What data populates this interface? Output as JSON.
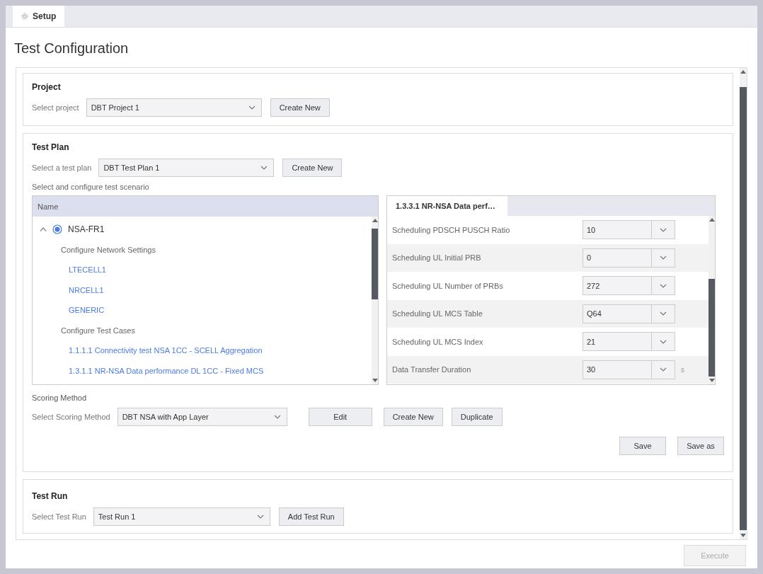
{
  "tab": {
    "label": "Setup",
    "selected": true
  },
  "title": "Test Configuration",
  "project": {
    "heading": "Project",
    "label": "Select project",
    "value": "DBT Project 1",
    "button": "Create New"
  },
  "test_plan": {
    "heading": "Test Plan",
    "label": "Select a test plan",
    "value": "DBT Test Plan 1",
    "button": "Create New",
    "scenario_label": "Select and configure test scenario",
    "tree": {
      "column": "Name",
      "items": [
        {
          "label": "NSA-FR1",
          "kind": "radio",
          "selected": true,
          "expanded": true,
          "children": [
            {
              "label": "Configure Network Settings",
              "kind": "group",
              "children": [
                {
                  "label": "LTECELL1",
                  "kind": "link"
                },
                {
                  "label": "NRCELL1",
                  "kind": "link"
                },
                {
                  "label": "GENERIC",
                  "kind": "link"
                }
              ]
            },
            {
              "label": "Configure Test Cases",
              "kind": "group",
              "children": [
                {
                  "label": "1.1.1.1 Connectivity test NSA 1CC - SCELL Aggregation",
                  "kind": "link"
                },
                {
                  "label": "1.3.1.1 NR-NSA Data performance DL 1CC - Fixed MCS",
                  "kind": "link"
                }
              ]
            }
          ]
        }
      ]
    },
    "params": {
      "tab": {
        "label": "1.3.3.1 NR-NSA Data perf…",
        "selected": true
      },
      "rows": [
        {
          "label": "Scheduling PDSCH PUSCH Ratio",
          "value": "10"
        },
        {
          "label": "Scheduling UL Initial PRB",
          "value": "0"
        },
        {
          "label": "Scheduling UL Number of PRBs",
          "value": "272"
        },
        {
          "label": "Scheduling UL MCS Table",
          "value": "Q64"
        },
        {
          "label": "Scheduling UL MCS Index",
          "value": "21"
        },
        {
          "label": "Data Transfer Duration",
          "value": "30",
          "unit": "s"
        }
      ]
    },
    "scoring": {
      "heading": "Scoring Method",
      "label": "Select Scoring Method",
      "value": "DBT NSA with App Layer",
      "buttons": [
        "Edit",
        "Create New",
        "Duplicate"
      ]
    },
    "save_buttons": [
      "Save",
      "Save as"
    ]
  },
  "test_run": {
    "heading": "Test Run",
    "label": "Select Test Run",
    "value": "Test Run 1",
    "button": "Add Test Run"
  },
  "execute": {
    "label": "Execute",
    "disabled": true
  }
}
